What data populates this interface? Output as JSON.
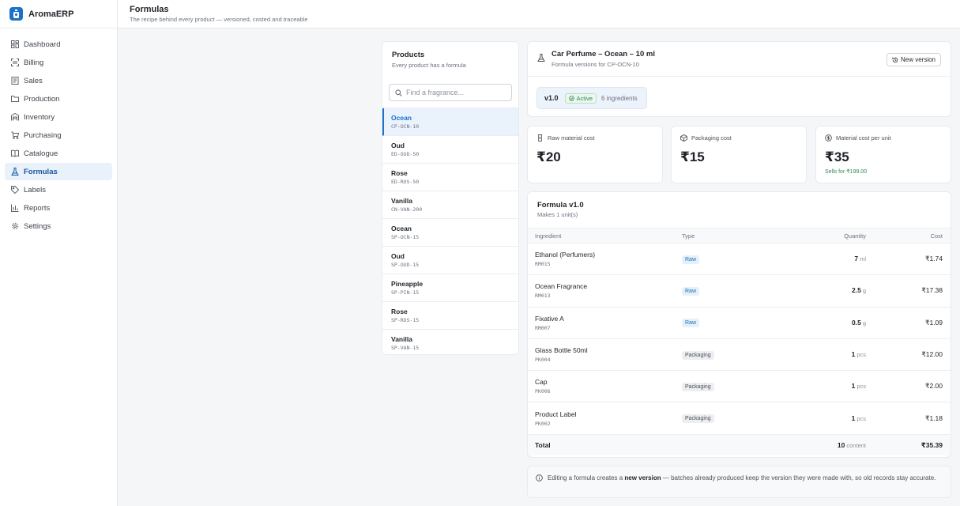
{
  "brand": {
    "name": "AromaERP",
    "color": "#1a73c8"
  },
  "page": {
    "title": "Formulas",
    "subtitle": "The recipe behind every product — versioned, costed and traceable"
  },
  "nav": [
    {
      "label": "Dashboard",
      "icon": "dashboard-icon"
    },
    {
      "label": "Billing",
      "icon": "scan-icon"
    },
    {
      "label": "Sales",
      "icon": "receipt-icon"
    },
    {
      "label": "Production",
      "icon": "folder-icon"
    },
    {
      "label": "Inventory",
      "icon": "warehouse-icon"
    },
    {
      "label": "Purchasing",
      "icon": "cart-icon"
    },
    {
      "label": "Catalogue",
      "icon": "book-icon"
    },
    {
      "label": "Formulas",
      "icon": "flask-icon",
      "active": true
    },
    {
      "label": "Labels",
      "icon": "tag-icon"
    },
    {
      "label": "Reports",
      "icon": "bar-chart-icon"
    },
    {
      "label": "Settings",
      "icon": "gear-icon"
    }
  ],
  "products": {
    "title": "Products",
    "subtitle": "Every product has a formula",
    "search_placeholder": "Find a fragrance...",
    "items": [
      {
        "name": "Ocean",
        "code": "CP-OCN-10",
        "active": true
      },
      {
        "name": "Oud",
        "code": "ED-OUD-50"
      },
      {
        "name": "Rose",
        "code": "ED-ROS-50"
      },
      {
        "name": "Vanilla",
        "code": "CN-VAN-200"
      },
      {
        "name": "Ocean",
        "code": "SP-OCN-15"
      },
      {
        "name": "Oud",
        "code": "SP-OUD-15"
      },
      {
        "name": "Pineapple",
        "code": "SP-PIN-15"
      },
      {
        "name": "Rose",
        "code": "SP-ROS-15"
      },
      {
        "name": "Vanilla",
        "code": "SP-VAN-15"
      }
    ]
  },
  "detail": {
    "name": "Car Perfume – Ocean – 10 ml",
    "subtitle": "Formula versions for CP-OCN-10",
    "new_version_label": "New version",
    "version": "v1.0",
    "status": "Active",
    "ingredient_count": "6 ingredients"
  },
  "metrics": {
    "raw": {
      "label": "Raw material cost",
      "value": "₹20"
    },
    "packaging": {
      "label": "Packaging cost",
      "value": "₹15"
    },
    "per_unit": {
      "label": "Material cost per unit",
      "value": "₹35",
      "note": "Sells for ₹199.00"
    }
  },
  "formula": {
    "title": "Formula v1.0",
    "subtitle": "Makes 1 unit(s)",
    "columns": {
      "ingredient": "Ingredient",
      "type": "Type",
      "quantity": "Quantity",
      "cost": "Cost"
    },
    "rows": [
      {
        "name": "Ethanol (Perfumers)",
        "code": "RM015",
        "type": "Raw",
        "qty": "7",
        "unit": "ml",
        "cost": "₹1.74"
      },
      {
        "name": "Ocean Fragrance",
        "code": "RM013",
        "type": "Raw",
        "qty": "2.5",
        "unit": "g",
        "cost": "₹17.38"
      },
      {
        "name": "Fixative A",
        "code": "RM007",
        "type": "Raw",
        "qty": "0.5",
        "unit": "g",
        "cost": "₹1.09"
      },
      {
        "name": "Glass Bottle 50ml",
        "code": "PK004",
        "type": "Packaging",
        "qty": "1",
        "unit": "pcs",
        "cost": "₹12.00"
      },
      {
        "name": "Cap",
        "code": "PK006",
        "type": "Packaging",
        "qty": "1",
        "unit": "pcs",
        "cost": "₹2.00"
      },
      {
        "name": "Product Label",
        "code": "PK002",
        "type": "Packaging",
        "qty": "1",
        "unit": "pcs",
        "cost": "₹1.18"
      }
    ],
    "total": {
      "label": "Total",
      "qty": "10",
      "unit": "content",
      "cost": "₹35.39"
    }
  },
  "note": {
    "before": "Editing a formula creates a ",
    "bold": "new version",
    "after": " — batches already produced keep the version they were made with, so old records stay accurate."
  }
}
